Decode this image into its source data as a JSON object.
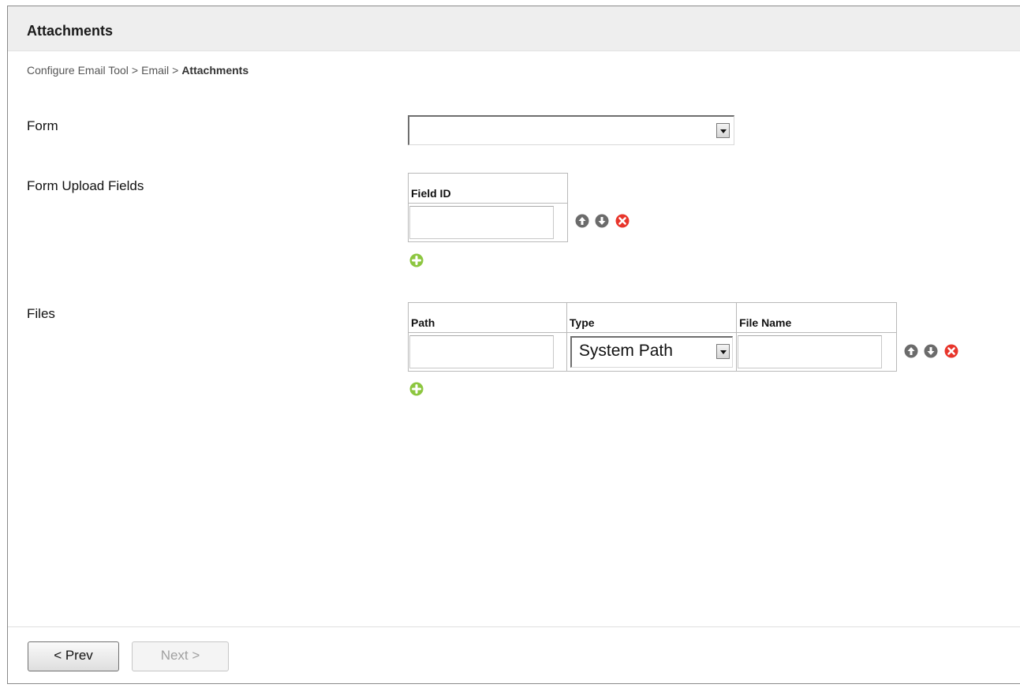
{
  "header": {
    "title": "Attachments"
  },
  "breadcrumb": {
    "items": [
      "Configure Email Tool",
      "Email"
    ],
    "separator": ">",
    "current": "Attachments"
  },
  "form": {
    "label": "Form",
    "selected_value": ""
  },
  "upload_fields": {
    "label": "Form Upload Fields",
    "columns": [
      "Field ID"
    ],
    "rows": [
      {
        "field_id": ""
      }
    ],
    "row_actions": [
      "move-up-icon",
      "move-down-icon",
      "remove-icon"
    ],
    "add_action": "add-icon"
  },
  "files": {
    "label": "Files",
    "columns": [
      "Path",
      "Type",
      "File Name"
    ],
    "rows": [
      {
        "path": "",
        "type": "System Path",
        "file_name": ""
      }
    ],
    "row_actions": [
      "move-up-icon",
      "move-down-icon",
      "remove-icon"
    ],
    "add_action": "add-icon"
  },
  "footer": {
    "prev_label": "< Prev",
    "next_label": "Next >",
    "next_enabled": false
  },
  "colors": {
    "remove": "#e8352b",
    "add": "#8cc63f",
    "arrow": "#6b6b6b"
  }
}
